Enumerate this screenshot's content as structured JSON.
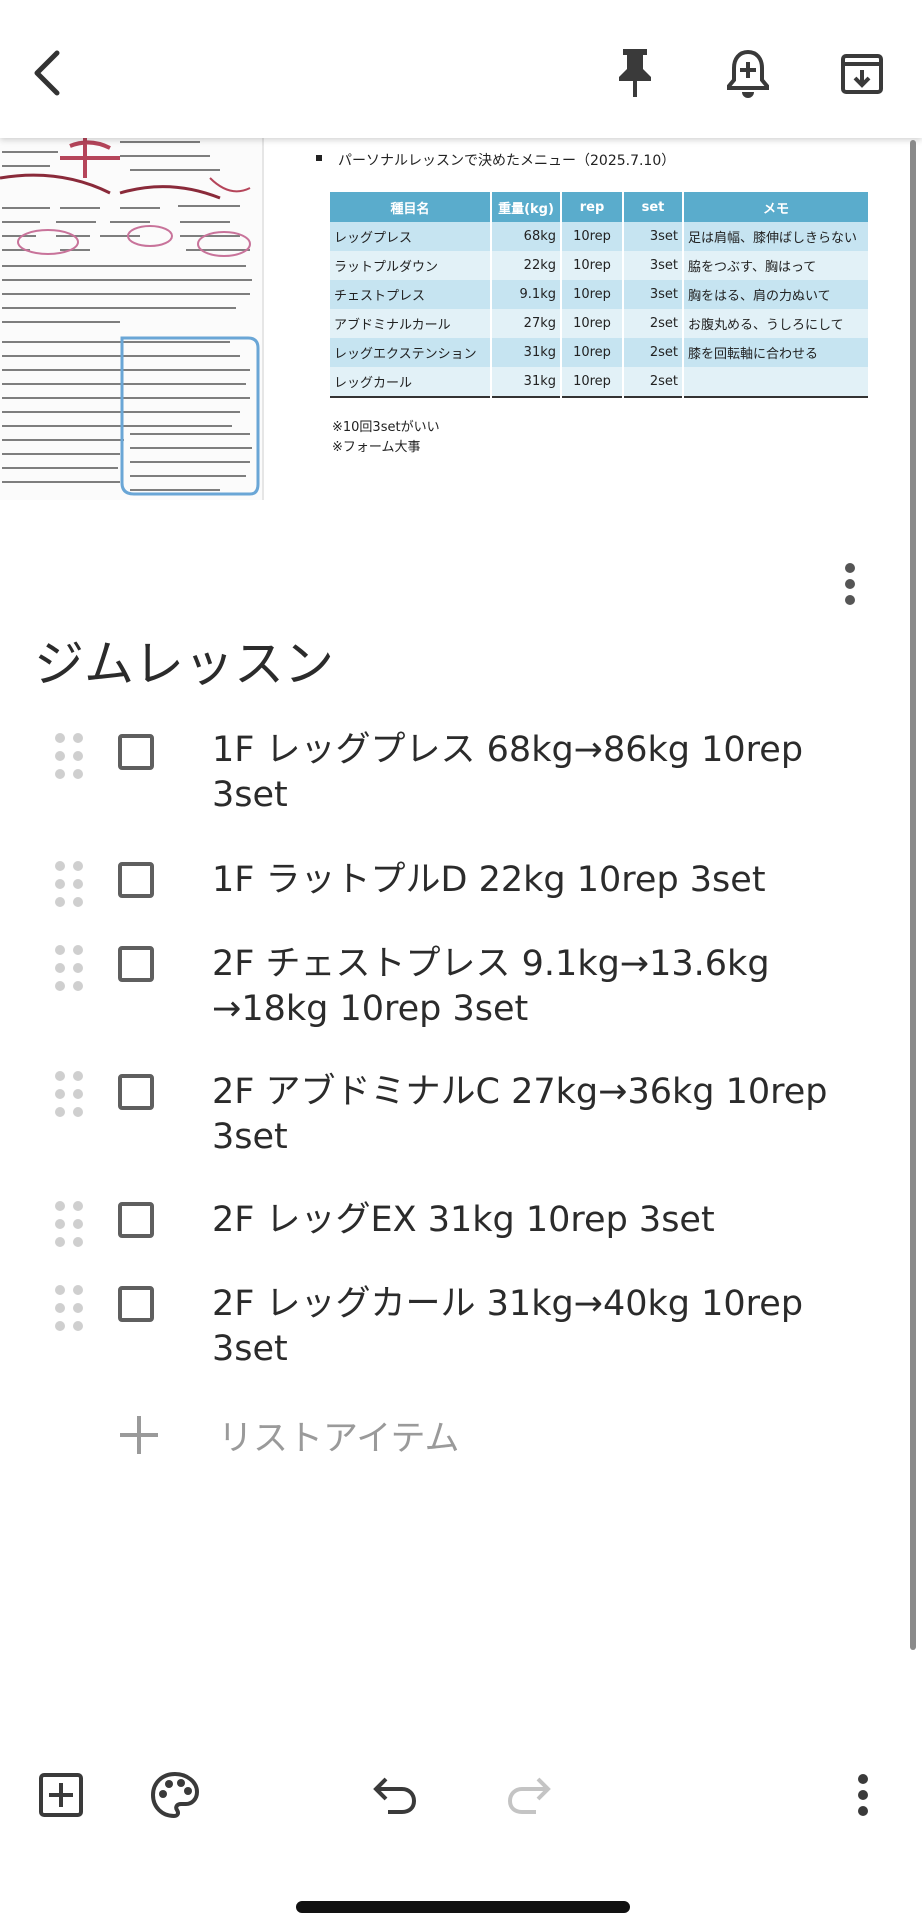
{
  "toolbar": {
    "back_icon": "chevron-left-icon",
    "pin_icon": "pin-icon",
    "reminder_icon": "add-alert-icon",
    "archive_icon": "archive-icon"
  },
  "attachments": {
    "right_image": {
      "heading": "パーソナルレッスンで決めたメニュー（2025.7.10）",
      "columns": [
        "種目名",
        "重量(kg)",
        "rep",
        "set",
        "メモ"
      ],
      "rows": [
        [
          "レッグプレス",
          "68kg",
          "10rep",
          "3set",
          "足は肩幅、膝伸ばしきらない"
        ],
        [
          "ラットプルダウン",
          "22kg",
          "10rep",
          "3set",
          "脇をつぶす、胸はって"
        ],
        [
          "チェストプレス",
          "9.1kg",
          "10rep",
          "3set",
          "胸をはる、肩の力ぬいて"
        ],
        [
          "アブドミナルカール",
          "27kg",
          "10rep",
          "2set",
          "お腹丸める、うしろにして"
        ],
        [
          "レッグエクステンション",
          "31kg",
          "10rep",
          "2set",
          "膝を回転軸に合わせる"
        ],
        [
          "レッグカール",
          "31kg",
          "10rep",
          "2set",
          ""
        ]
      ],
      "notes": [
        "※10回3setがいい",
        "※フォーム大事"
      ]
    }
  },
  "note": {
    "title": "ジムレッスン",
    "items": [
      {
        "text": "1F レッグプレス 68kg→86kg 10rep 3set",
        "checked": false
      },
      {
        "text": "1F ラットプルD 22kg 10rep 3set",
        "checked": false
      },
      {
        "text": "2F チェストプレス 9.1kg→13.6kg →18kg 10rep 3set",
        "checked": false
      },
      {
        "text": "2F アブドミナルC 27kg→36kg 10rep 3set",
        "checked": false
      },
      {
        "text": "2F レッグEX 31kg 10rep 3set",
        "checked": false
      },
      {
        "text": "2F レッグカール 31kg→40kg 10rep 3set",
        "checked": false
      }
    ],
    "add_item_placeholder": "リストアイテム"
  },
  "bottom_bar": {
    "add_icon": "add-box-icon",
    "palette_icon": "palette-icon",
    "undo_icon": "undo-icon",
    "redo_icon": "redo-icon",
    "more_icon": "more-vert-icon"
  }
}
